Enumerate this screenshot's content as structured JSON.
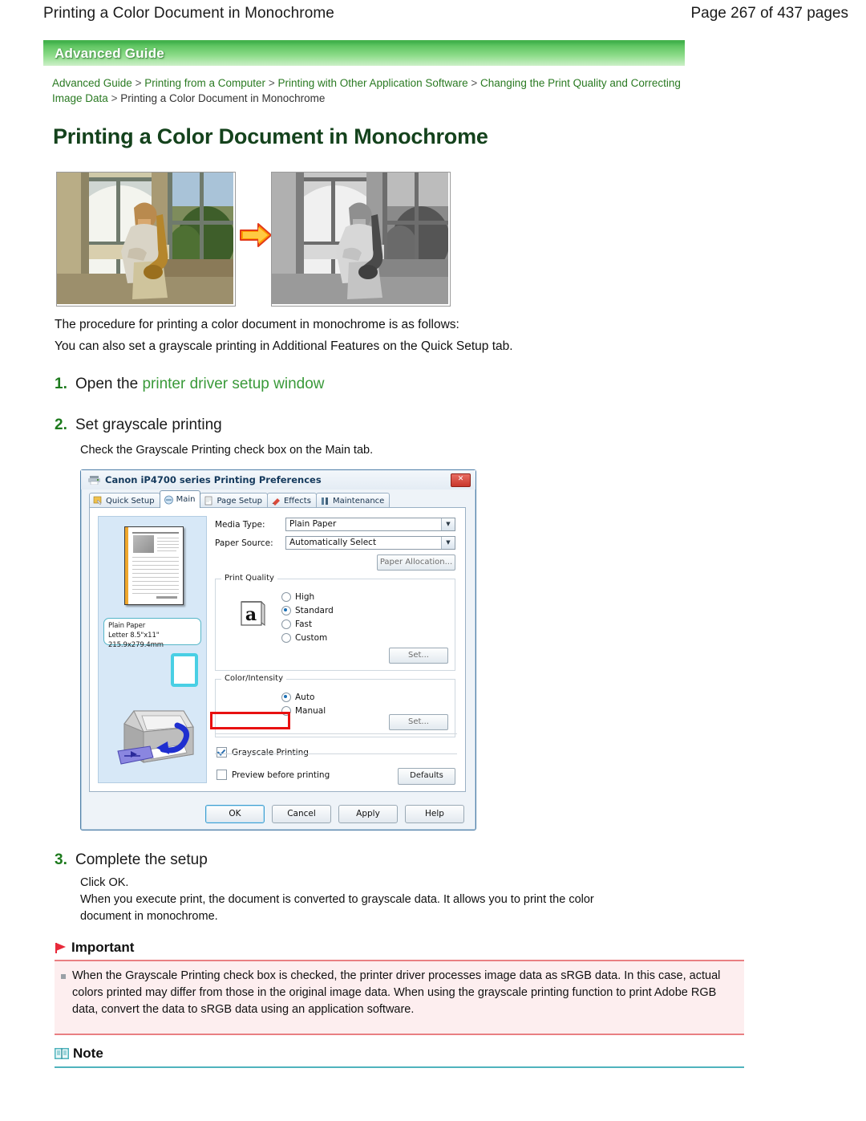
{
  "header": {
    "title": "Printing a Color Document in Monochrome",
    "page_label": "Page 267 of 437 pages"
  },
  "banner": {
    "label": "Advanced Guide"
  },
  "breadcrumb": {
    "items": [
      "Advanced Guide",
      "Printing from a Computer",
      "Printing with Other Application Software",
      "Changing the Print Quality and Correcting Image Data",
      "Printing a Color Document in Monochrome"
    ],
    "separator": ">"
  },
  "doc_title": "Printing a Color Document in Monochrome",
  "images": {
    "before_alt": "color-photo-saxophone-player",
    "after_alt": "monochrome-photo-saxophone-player",
    "arrow_alt": "orange-right-arrow"
  },
  "intro": {
    "line1": "The procedure for printing a color document in monochrome is as follows:",
    "line2": "You can also set a grayscale printing in Additional Features on the Quick Setup tab."
  },
  "steps": [
    {
      "num": "1.",
      "text_before": "Open the ",
      "link": "printer driver setup window",
      "body": ""
    },
    {
      "num": "2.",
      "text_before": "Set grayscale printing",
      "link": "",
      "body": "Check the Grayscale Printing check box on the Main tab."
    },
    {
      "num": "3.",
      "text_before": "Complete the setup",
      "link": "",
      "body_line1": "Click OK.",
      "body_line2": "When you execute print, the document is converted to grayscale data. It allows you to print the color",
      "body_line3": "document in monochrome."
    }
  ],
  "dialog": {
    "title": "Canon iP4700 series Printing Preferences",
    "close_label": "✕",
    "tabs": [
      {
        "label": "Quick Setup",
        "selected": false
      },
      {
        "label": "Main",
        "selected": true
      },
      {
        "label": "Page Setup",
        "selected": false
      },
      {
        "label": "Effects",
        "selected": false
      },
      {
        "label": "Maintenance",
        "selected": false
      }
    ],
    "preview": {
      "paper_line1": "Plain Paper",
      "paper_line2": "Letter 8.5\"x11\" 215.9x279.4mm"
    },
    "media_type": {
      "label": "Media Type:",
      "value": "Plain Paper"
    },
    "paper_source": {
      "label": "Paper Source:",
      "value": "Automatically Select"
    },
    "paper_allocation_button": "Paper Allocation...",
    "print_quality": {
      "title": "Print Quality",
      "options": [
        {
          "label": "High",
          "selected": false
        },
        {
          "label": "Standard",
          "selected": true
        },
        {
          "label": "Fast",
          "selected": false
        },
        {
          "label": "Custom",
          "selected": false
        }
      ],
      "set_button": "Set..."
    },
    "color_intensity": {
      "title": "Color/Intensity",
      "options": [
        {
          "label": "Auto",
          "selected": true
        },
        {
          "label": "Manual",
          "selected": false
        }
      ],
      "set_button": "Set..."
    },
    "grayscale_printing": {
      "label": "Grayscale Printing",
      "checked": true
    },
    "preview_before_printing": {
      "label": "Preview before printing",
      "checked": false
    },
    "defaults_button": "Defaults",
    "buttons": [
      "OK",
      "Cancel",
      "Apply",
      "Help"
    ]
  },
  "important": {
    "heading": "Important",
    "bullets": [
      "When the Grayscale Printing check box is checked, the printer driver processes image data as sRGB data. In this case, actual colors printed may differ from those in the original image data. When using the grayscale printing function to print Adobe RGB data, convert the data to sRGB data using an application software."
    ]
  },
  "note": {
    "heading": "Note"
  },
  "colors": {
    "brand_green": "#3faf4a",
    "link_green": "#2a7a22",
    "title_green": "#14421c",
    "highlight_red": "#e81010",
    "important_bg": "#fdeeef",
    "important_rule": "#e97f82",
    "note_rule": "#4fb3bd"
  }
}
